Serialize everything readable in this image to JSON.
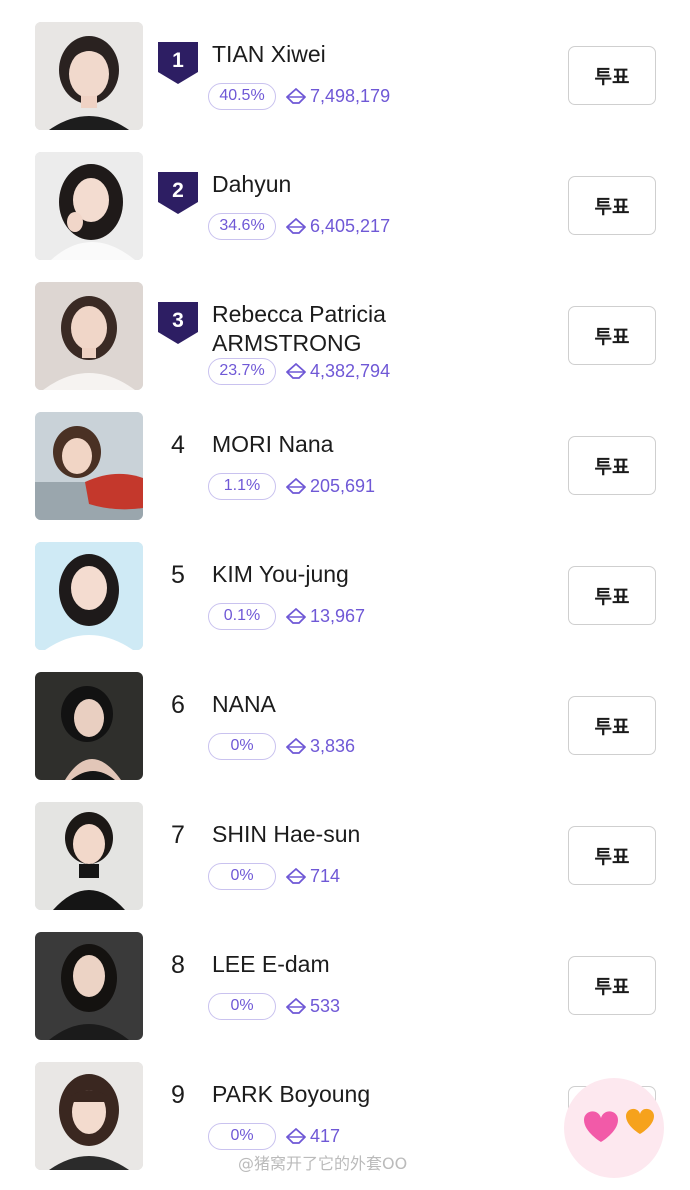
{
  "vote_label": "투표",
  "watermark": "@猪窝开了它的外套OO",
  "colors": {
    "accent": "#6f58d6",
    "rank_badge": "#2d1e63",
    "pill_border": "#c9c2ef"
  },
  "rows": [
    {
      "rank": "1",
      "name": "TIAN Xiwei",
      "percent": "40.5%",
      "votes": "7,498,179",
      "badge": true
    },
    {
      "rank": "2",
      "name": "Dahyun",
      "percent": "34.6%",
      "votes": "6,405,217",
      "badge": true
    },
    {
      "rank": "3",
      "name_line1": "Rebecca Patricia",
      "name_line2": "ARMSTRONG",
      "percent": "23.7%",
      "votes": "4,382,794",
      "badge": true
    },
    {
      "rank": "4",
      "name": "MORI Nana",
      "percent": "1.1%",
      "votes": "205,691",
      "badge": false
    },
    {
      "rank": "5",
      "name": "KIM You-jung",
      "percent": "0.1%",
      "votes": "13,967",
      "badge": false
    },
    {
      "rank": "6",
      "name": "NANA",
      "percent": "0%",
      "votes": "3,836",
      "badge": false
    },
    {
      "rank": "7",
      "name": "SHIN Hae-sun",
      "percent": "0%",
      "votes": "714",
      "badge": false
    },
    {
      "rank": "8",
      "name": "LEE E-dam",
      "percent": "0%",
      "votes": "533",
      "badge": false
    },
    {
      "rank": "9",
      "name": "PARK Boyoung",
      "percent": "0%",
      "votes": "417",
      "badge": false
    }
  ]
}
